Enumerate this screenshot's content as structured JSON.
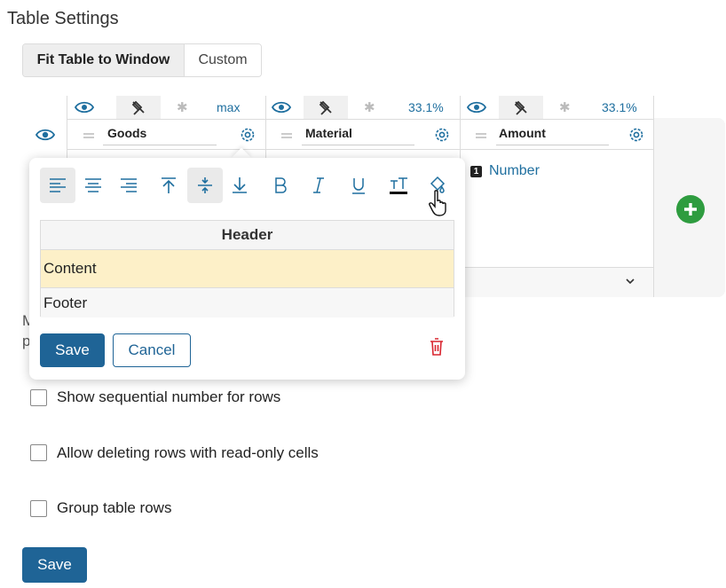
{
  "page_title": "Table Settings",
  "fit_mode": {
    "options": [
      "Fit Table to Window",
      "Custom"
    ],
    "selected": "Fit Table to Window"
  },
  "columns": [
    {
      "name": "Goods",
      "width": "max"
    },
    {
      "name": "Material",
      "width": "33.1%"
    },
    {
      "name": "Amount",
      "width": "33.1%"
    }
  ],
  "amount_cell": {
    "badge": "1",
    "type_label": "Number"
  },
  "format_popup": {
    "toolbar": [
      "align-left",
      "align-center",
      "align-right",
      "align-top",
      "align-middle",
      "align-bottom",
      "bold",
      "italic",
      "underline",
      "text-color",
      "fill-color"
    ],
    "rows": {
      "header": "Header",
      "content": "Content",
      "footer": "Footer"
    },
    "content_highlight": "#fdf0c8",
    "save_label": "Save",
    "cancel_label": "Cancel"
  },
  "obscured_text": {
    "line1": "M",
    "line2": "p"
  },
  "options": [
    {
      "label": "Show sequential number for rows",
      "checked": false
    },
    {
      "label": "Allow deleting rows with read-only cells",
      "checked": false
    },
    {
      "label": "Group table rows",
      "checked": false
    }
  ],
  "save_label": "Save",
  "colors": {
    "primary": "#1f6496",
    "link": "#1f6f9f",
    "add": "#2e9c3f",
    "delete": "#d9252f"
  }
}
